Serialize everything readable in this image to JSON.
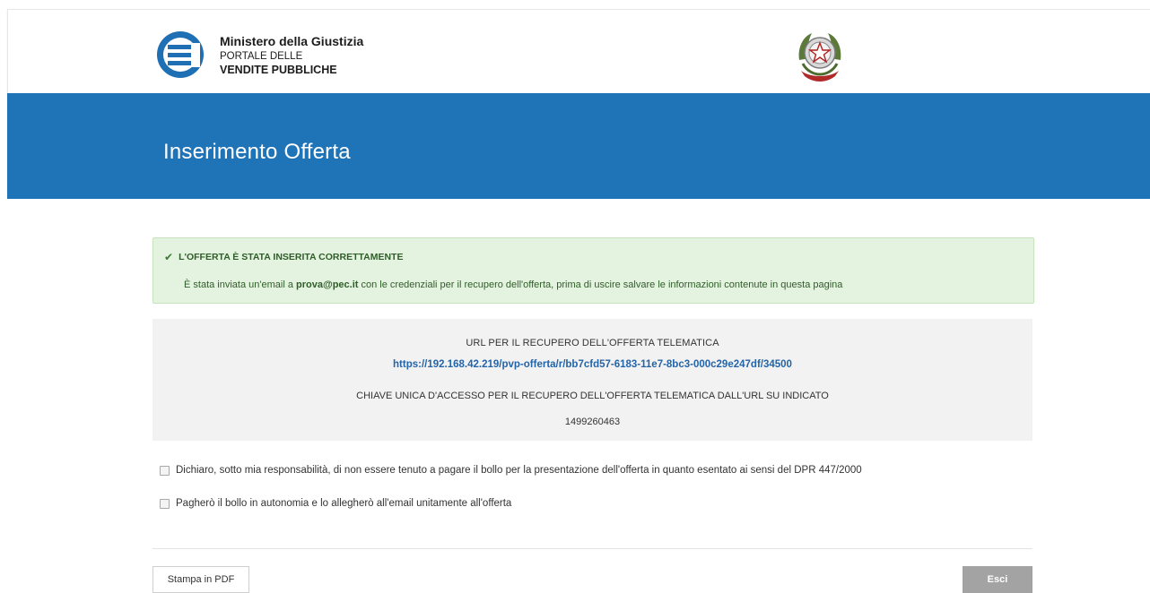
{
  "header": {
    "ministry": "Ministero della Giustizia",
    "portal_line1": "PORTALE DELLE",
    "portal_line2": "VENDITE PUBBLICHE"
  },
  "banner": {
    "title": "Inserimento Offerta"
  },
  "alert": {
    "title": "L'OFFERTA È STATA INSERITA CORRETTAMENTE",
    "msg_before": "È stata inviata un'email a ",
    "email": "prova@pec.it",
    "msg_after": " con le credenziali per il recupero dell'offerta, prima di uscire salvare le informazioni contenute in questa pagina"
  },
  "info": {
    "url_label": "URL PER IL RECUPERO DELL'OFFERTA TELEMATICA",
    "url": "https://192.168.42.219/pvp-offerta/r/bb7cfd57-6183-11e7-8bc3-000c29e247df/34500",
    "key_label": "CHIAVE UNICA D'ACCESSO PER IL RECUPERO DELL'OFFERTA TELEMATICA DALL'URL SU INDICATO",
    "key": "1499260463"
  },
  "checkboxes": [
    {
      "label": "Dichiaro, sotto mia responsabilità, di non essere tenuto a pagare il bollo per la presentazione dell'offerta in quanto esentato ai sensi del DPR 447/2000",
      "checked": false
    },
    {
      "label": "Pagherò il bollo in autonomia e lo allegherò all'email unitamente all'offerta",
      "checked": false
    }
  ],
  "buttons": {
    "pdf": "Stampa in PDF",
    "exit": "Esci"
  },
  "colors": {
    "brand_blue": "#1f73b7",
    "success_bg": "#e4f3df",
    "success_text": "#2f5d29",
    "link": "#2464a8",
    "exit_button": "#a3a3a3"
  },
  "icons": {
    "logo": "ministry-logo-icon",
    "emblem": "italian-republic-emblem-icon",
    "alert": "checkmark-icon"
  }
}
